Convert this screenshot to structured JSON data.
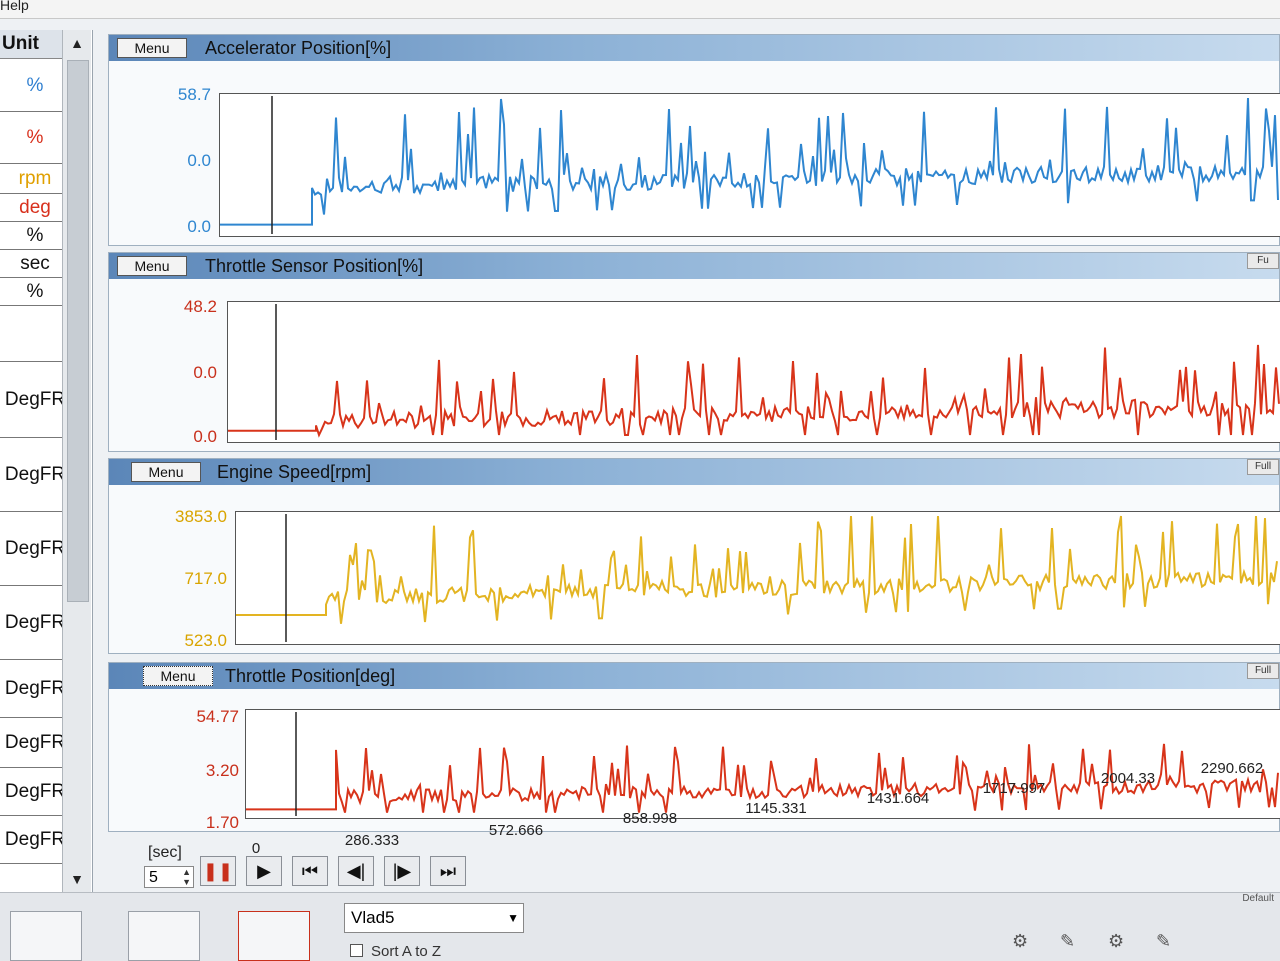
{
  "menubar": {
    "help": "Help"
  },
  "unit_list": {
    "header": "Unit",
    "items": [
      {
        "label": "%",
        "color": "#2f7fd0"
      },
      {
        "label": "%",
        "color": "#d8301c"
      },
      {
        "label": "rpm",
        "color": "#e0a000"
      },
      {
        "label": "deg",
        "color": "#d8301c"
      },
      {
        "label": "%",
        "color": "#111111"
      },
      {
        "label": "sec",
        "color": "#111111"
      },
      {
        "label": "%",
        "color": "#111111"
      },
      {
        "label": "",
        "color": "#111111"
      },
      {
        "label": "DegFR",
        "color": "#111111"
      },
      {
        "label": "DegFR",
        "color": "#111111"
      },
      {
        "label": "DegFR",
        "color": "#111111"
      },
      {
        "label": "DegFR",
        "color": "#111111"
      },
      {
        "label": "DegFR",
        "color": "#111111"
      },
      {
        "label": "DegFR",
        "color": "#111111"
      },
      {
        "label": "DegFR",
        "color": "#111111"
      },
      {
        "label": "DegFR",
        "color": "#111111"
      }
    ]
  },
  "panels": [
    {
      "menu_label": "Menu",
      "title": "Accelerator Position[%]",
      "color": "#2f86d0",
      "y_labels": [
        "58.7",
        "0.0",
        "0.0"
      ],
      "full_label": ""
    },
    {
      "menu_label": "Menu",
      "title": "Throttle Sensor Position[%]",
      "color": "#d8341a",
      "y_labels": [
        "48.2",
        "0.0",
        "0.0"
      ],
      "full_label": "Fu"
    },
    {
      "menu_label": "Menu",
      "title": "Engine Speed[rpm]",
      "color": "#e3b422",
      "y_labels": [
        "3853.0",
        "717.0",
        "523.0"
      ],
      "full_label": "Full"
    },
    {
      "menu_label": "Menu",
      "title": "Throttle Position[deg]",
      "color": "#d8341a",
      "y_labels": [
        "54.77",
        "3.20",
        "1.70"
      ],
      "full_label": "Full"
    }
  ],
  "x_axis": {
    "ticks": [
      "0",
      "286.333",
      "572.666",
      "858.998",
      "1145.331",
      "1431.664",
      "1717.997",
      "2004.33",
      "2290.662"
    ]
  },
  "controls": {
    "unit_label": "[sec]",
    "step_value": "5",
    "icons": [
      "pause-icon",
      "play-icon",
      "skip-to-start-icon",
      "step-back-icon",
      "step-forward-icon",
      "skip-to-end-icon"
    ]
  },
  "toolbar": {
    "profile_select": "Vlad5",
    "sort_label": "Sort A to Z",
    "default_label": "Default"
  }
}
